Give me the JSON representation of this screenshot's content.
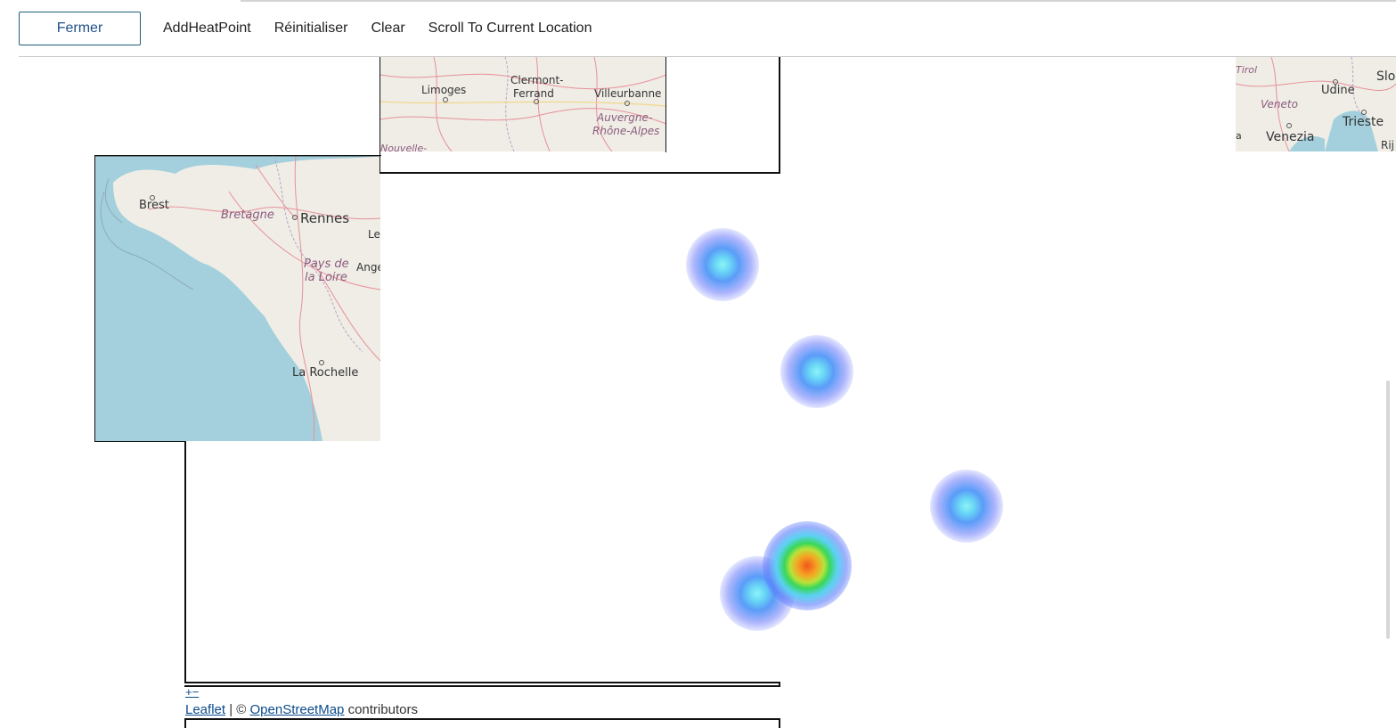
{
  "toolbar": {
    "close_label": "Fermer",
    "add_heat_point_label": "AddHeatPoint",
    "reset_label": "Réinitialiser",
    "clear_label": "Clear",
    "scroll_label": "Scroll To Current Location"
  },
  "map_tiles": {
    "center_tile": {
      "cities": [
        "Limoges",
        "Clermont-",
        "Ferrand",
        "Villeurbanne"
      ],
      "regions": [
        "Auvergne-",
        "Rhône-Alpes",
        "Nouvelle-"
      ]
    },
    "west_tile": {
      "cities": [
        "Brest",
        "Rennes",
        "La Rochelle",
        "Le",
        "Ange"
      ],
      "regions": [
        "Bretagne",
        "Pays de",
        "la Loire"
      ]
    },
    "east_tile": {
      "cities": [
        "Udine",
        "Trieste",
        "Venezia",
        "Slo",
        "Rij"
      ],
      "regions": [
        "Veneto",
        "Tirol",
        "a"
      ]
    }
  },
  "heatmap": {
    "points": [
      {
        "intensity": "low",
        "color": "#6ad8f6"
      },
      {
        "intensity": "low",
        "color": "#6ad8f6"
      },
      {
        "intensity": "low",
        "color": "#6ad8f6"
      },
      {
        "intensity": "low",
        "color": "#6ad8f6"
      },
      {
        "intensity": "high",
        "color": "#f26a1b"
      }
    ]
  },
  "map_controls": {
    "zoom_in": "+",
    "zoom_out": "−"
  },
  "attribution": {
    "leaflet_link": "Leaflet",
    "separator": " | © ",
    "osm_link": "OpenStreetMap",
    "suffix": " contributors"
  },
  "colors": {
    "water": "#a3d0dc",
    "land": "#f0eee7",
    "road": "#e8909a",
    "accent": "#1f4f8a"
  }
}
